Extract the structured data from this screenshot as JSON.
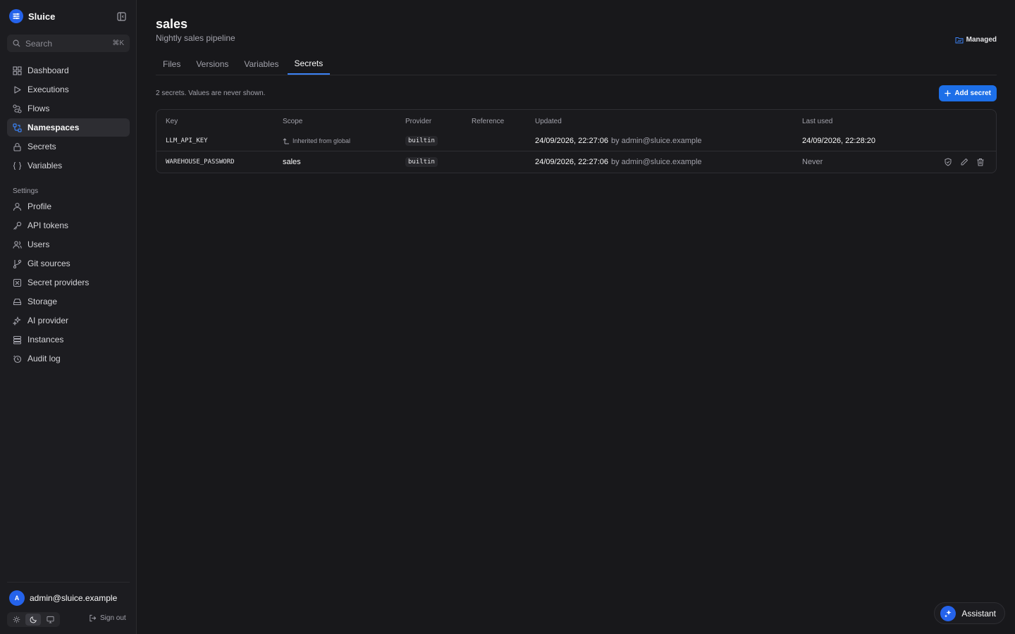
{
  "app": {
    "name": "Sluice"
  },
  "search": {
    "placeholder": "Search",
    "shortcut": "⌘K"
  },
  "nav": {
    "items": [
      {
        "label": "Dashboard",
        "icon": "dashboard-icon"
      },
      {
        "label": "Executions",
        "icon": "play-icon"
      },
      {
        "label": "Flows",
        "icon": "flows-icon"
      },
      {
        "label": "Namespaces",
        "icon": "namespaces-icon",
        "active": true
      },
      {
        "label": "Secrets",
        "icon": "lock-icon"
      },
      {
        "label": "Variables",
        "icon": "braces-icon"
      }
    ],
    "settings_label": "Settings",
    "settings_items": [
      {
        "label": "Profile",
        "icon": "user-icon"
      },
      {
        "label": "API tokens",
        "icon": "key-icon"
      },
      {
        "label": "Users",
        "icon": "users-icon"
      },
      {
        "label": "Git sources",
        "icon": "git-branch-icon"
      },
      {
        "label": "Secret providers",
        "icon": "secret-box-icon"
      },
      {
        "label": "Storage",
        "icon": "storage-icon"
      },
      {
        "label": "AI provider",
        "icon": "sparkles-icon"
      },
      {
        "label": "Instances",
        "icon": "server-icon"
      },
      {
        "label": "Audit log",
        "icon": "audit-icon"
      }
    ]
  },
  "user": {
    "initial": "A",
    "email": "admin@sluice.example",
    "signout_label": "Sign out"
  },
  "page": {
    "title": "sales",
    "subtitle": "Nightly sales pipeline",
    "managed_label": "Managed",
    "tabs": [
      {
        "label": "Files"
      },
      {
        "label": "Versions"
      },
      {
        "label": "Variables"
      },
      {
        "label": "Secrets",
        "active": true
      }
    ],
    "info": "2 secrets. Values are never shown.",
    "add_label": "Add secret"
  },
  "table": {
    "headers": {
      "key": "Key",
      "scope": "Scope",
      "provider": "Provider",
      "reference": "Reference",
      "updated": "Updated",
      "last_used": "Last used"
    },
    "rows": [
      {
        "key": "LLM_API_KEY",
        "scope": "Inherited from global",
        "inherited": true,
        "provider": "builtin",
        "reference": "",
        "updated": "24/09/2026, 22:27:06",
        "updated_by": "by admin@sluice.example",
        "last_used": "24/09/2026, 22:28:20"
      },
      {
        "key": "WAREHOUSE_PASSWORD",
        "scope": "sales",
        "inherited": false,
        "provider": "builtin",
        "reference": "",
        "updated": "24/09/2026, 22:27:06",
        "updated_by": "by admin@sluice.example",
        "last_used": "Never"
      }
    ]
  },
  "assistant": {
    "label": "Assistant"
  },
  "colors": {
    "accent": "#1d6fe8",
    "background": "#18181b",
    "sidebar": "#1c1c20"
  }
}
